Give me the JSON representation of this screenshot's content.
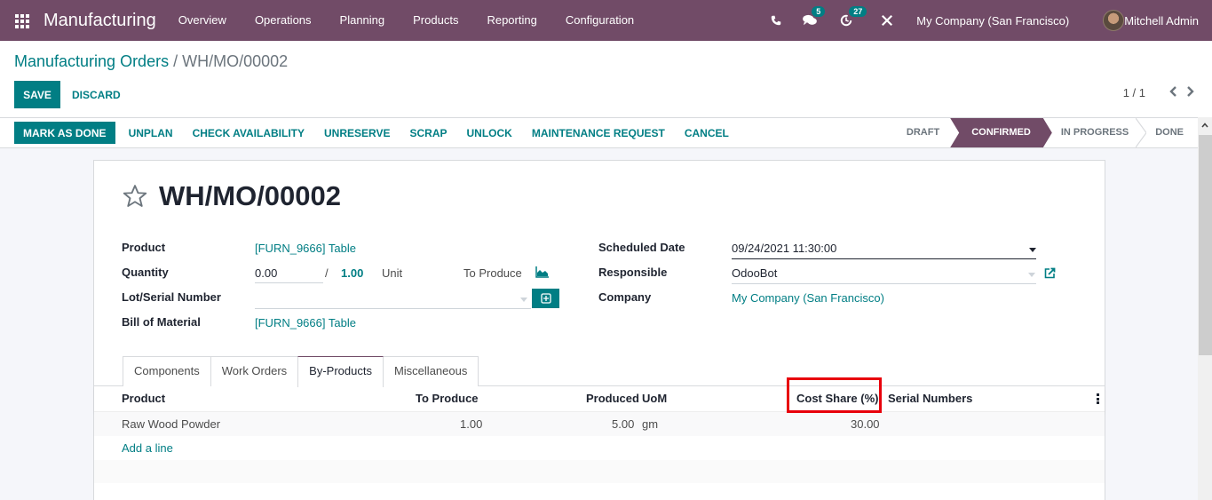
{
  "navbar": {
    "app_name": "Manufacturing",
    "menu": [
      "Overview",
      "Operations",
      "Planning",
      "Products",
      "Reporting",
      "Configuration"
    ],
    "messages_badge": "5",
    "activities_badge": "27",
    "company": "My Company (San Francisco)",
    "user": "Mitchell Admin"
  },
  "breadcrumb": {
    "parent": "Manufacturing Orders",
    "separator": "/",
    "current": "WH/MO/00002"
  },
  "toolbar": {
    "save_label": "SAVE",
    "discard_label": "DISCARD"
  },
  "pager": {
    "value": "1 / 1",
    "prev": "‹",
    "next": "›"
  },
  "actions": {
    "mark_as_done": "MARK AS DONE",
    "buttons": [
      "UNPLAN",
      "CHECK AVAILABILITY",
      "UNRESERVE",
      "SCRAP",
      "UNLOCK",
      "MAINTENANCE REQUEST",
      "CANCEL"
    ]
  },
  "stages": {
    "items": [
      "DRAFT",
      "CONFIRMED",
      "IN PROGRESS",
      "DONE"
    ],
    "active": "CONFIRMED"
  },
  "record": {
    "title": "WH/MO/00002",
    "fields_left": {
      "product_label": "Product",
      "product_value": "[FURN_9666] Table",
      "quantity_label": "Quantity",
      "quantity_value": "0.00",
      "quantity_sep": "/",
      "quantity_target": "1.00",
      "quantity_uom": "Unit",
      "to_produce_label": "To Produce",
      "lot_label": "Lot/Serial Number",
      "lot_value": "",
      "bom_label": "Bill of Material",
      "bom_value": "[FURN_9666] Table"
    },
    "fields_right": {
      "scheduled_date_label": "Scheduled Date",
      "scheduled_date_value": "09/24/2021 11:30:00",
      "responsible_label": "Responsible",
      "responsible_value": "OdooBot",
      "company_label": "Company",
      "company_value": "My Company (San Francisco)"
    }
  },
  "notebook": {
    "tabs": [
      "Components",
      "Work Orders",
      "By-Products",
      "Miscellaneous"
    ],
    "active_tab": "By-Products"
  },
  "byproducts_table": {
    "columns": [
      "Product",
      "To Produce",
      "Produced",
      "UoM",
      "Cost Share (%)",
      "Serial Numbers"
    ],
    "rows": [
      {
        "product": "Raw Wood Powder",
        "to_produce": "1.00",
        "produced": "5.00",
        "uom": "gm",
        "cost_share": "30.00",
        "serial_numbers": ""
      }
    ],
    "add_line": "Add a line",
    "highlighted_column": "Cost Share (%)"
  },
  "colors": {
    "brand": "#714b67",
    "primary": "#017e84",
    "highlight": "#e8000b"
  }
}
